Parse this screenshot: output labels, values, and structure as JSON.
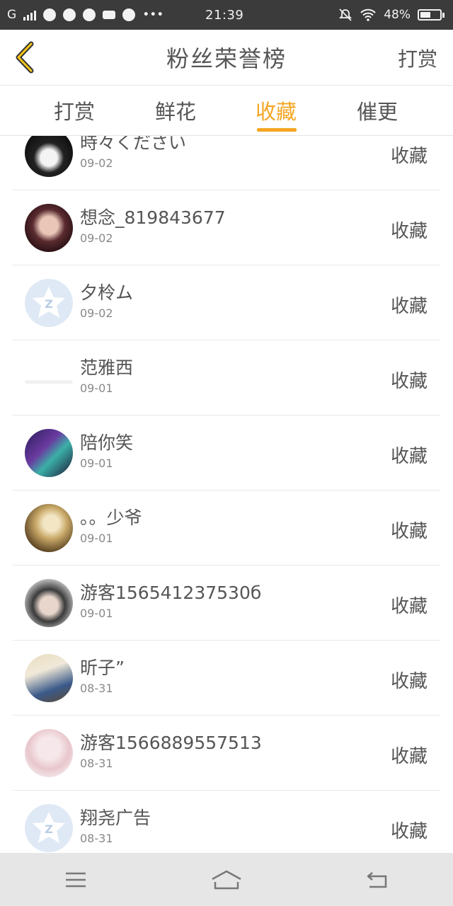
{
  "status_bar": {
    "network": "G",
    "time": "21:39",
    "battery": "48%"
  },
  "header": {
    "title": "粉丝荣誉榜",
    "action": "打赏",
    "back_icon": "chevron-left-icon"
  },
  "tabs": [
    {
      "label": "打赏",
      "active": false
    },
    {
      "label": "鲜花",
      "active": false
    },
    {
      "label": "收藏",
      "active": true
    },
    {
      "label": "催更",
      "active": false
    }
  ],
  "accent_color": "#f5a623",
  "rows": [
    {
      "name": "時々ください",
      "date": "09-02",
      "action": "收藏",
      "avatar": "photo"
    },
    {
      "name": "想念_819843677",
      "date": "09-02",
      "action": "收藏",
      "avatar": "photo"
    },
    {
      "name": "夕柃ム",
      "date": "09-02",
      "action": "收藏",
      "avatar": "qq-default"
    },
    {
      "name": "范雅西",
      "date": "09-01",
      "action": "收藏",
      "avatar": "photo"
    },
    {
      "name": "陪你笑",
      "date": "09-01",
      "action": "收藏",
      "avatar": "photo"
    },
    {
      "name": "。。少爷",
      "date": "09-01",
      "action": "收藏",
      "avatar": "photo"
    },
    {
      "name": "游客156541237530б",
      "date": "09-01",
      "action": "收藏",
      "avatar": "photo"
    },
    {
      "name": "昕子”",
      "date": "08-31",
      "action": "收藏",
      "avatar": "photo"
    },
    {
      "name": "游客1566889557513",
      "date": "08-31",
      "action": "收藏",
      "avatar": "photo"
    },
    {
      "name": "翔尧广告",
      "date": "08-31",
      "action": "收藏",
      "avatar": "qq-default"
    }
  ],
  "nav_bar": {
    "menu_icon": "menu-icon",
    "home_icon": "home-icon",
    "back_icon": "back-icon"
  }
}
